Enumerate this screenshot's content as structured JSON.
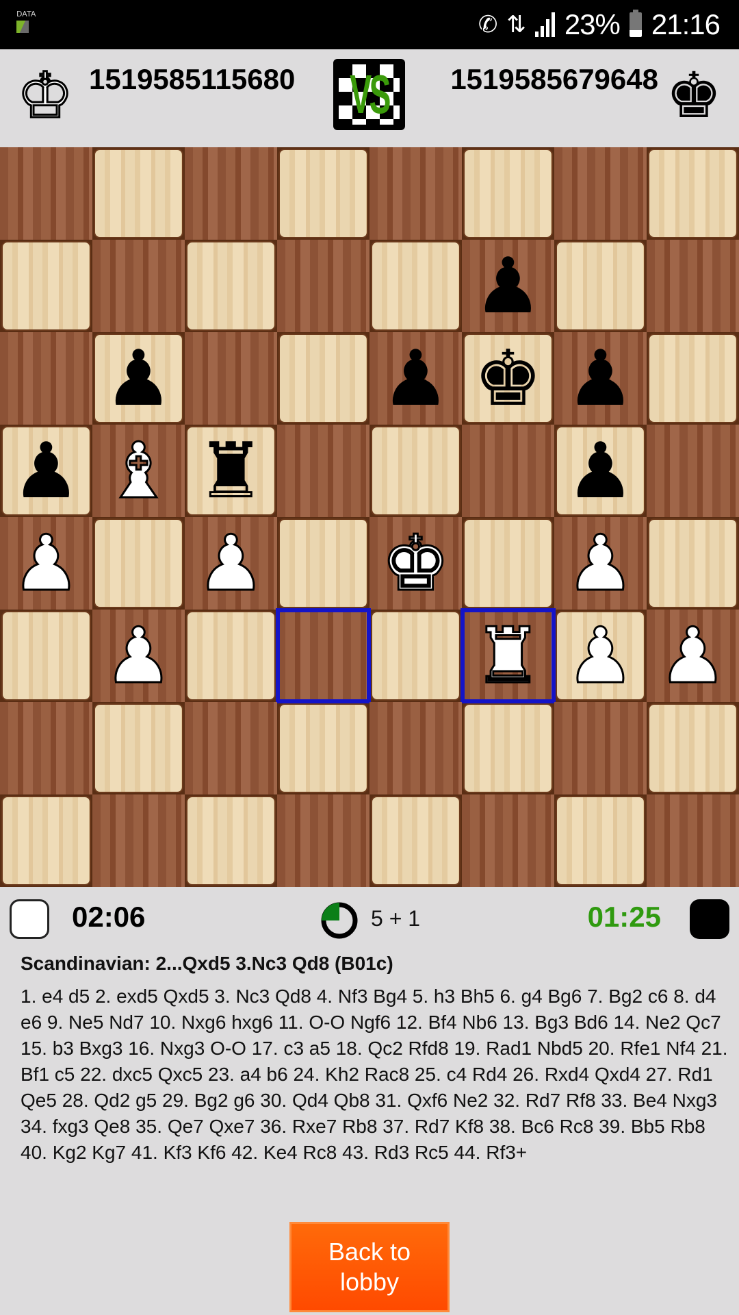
{
  "status_bar": {
    "data_label": "DATA",
    "battery_percent": "23%",
    "battery_level": 0.23,
    "time": "21:16",
    "icons": [
      "call-wifi-icon",
      "wifi-icon",
      "signal-icon",
      "battery-icon"
    ]
  },
  "header": {
    "player_white": {
      "name": "1519585115680",
      "icon": "white-king-icon"
    },
    "player_black": {
      "name": "1519585679648",
      "icon": "black-king-icon"
    },
    "vs_label": "VS"
  },
  "board": {
    "orientation": "white-bottom",
    "highlighted_squares": [
      "d3",
      "f3"
    ],
    "pieces": [
      {
        "square": "f7",
        "color": "b",
        "type": "pawn",
        "glyph": "♟"
      },
      {
        "square": "b6",
        "color": "b",
        "type": "pawn",
        "glyph": "♟"
      },
      {
        "square": "e6",
        "color": "b",
        "type": "pawn",
        "glyph": "♟"
      },
      {
        "square": "f6",
        "color": "b",
        "type": "king",
        "glyph": "♚"
      },
      {
        "square": "g6",
        "color": "b",
        "type": "pawn",
        "glyph": "♟"
      },
      {
        "square": "a5",
        "color": "b",
        "type": "pawn",
        "glyph": "♟"
      },
      {
        "square": "b5",
        "color": "w",
        "type": "bishop",
        "glyph": "♝"
      },
      {
        "square": "c5",
        "color": "b",
        "type": "rook",
        "glyph": "♜"
      },
      {
        "square": "g5",
        "color": "b",
        "type": "pawn",
        "glyph": "♟"
      },
      {
        "square": "a4",
        "color": "w",
        "type": "pawn",
        "glyph": "♟"
      },
      {
        "square": "c4",
        "color": "w",
        "type": "pawn",
        "glyph": "♟"
      },
      {
        "square": "e4",
        "color": "w",
        "type": "king",
        "glyph": "♚"
      },
      {
        "square": "g4",
        "color": "w",
        "type": "pawn",
        "glyph": "♟"
      },
      {
        "square": "b3",
        "color": "w",
        "type": "pawn",
        "glyph": "♟"
      },
      {
        "square": "f3",
        "color": "w",
        "type": "rook",
        "glyph": "♜"
      },
      {
        "square": "g3",
        "color": "w",
        "type": "pawn",
        "glyph": "♟"
      },
      {
        "square": "h3",
        "color": "w",
        "type": "pawn",
        "glyph": "♟"
      }
    ]
  },
  "clocks": {
    "white_time": "02:06",
    "black_time": "01:25",
    "active_color_hex": "#2f9a0f",
    "time_control": "5 + 1",
    "timer_icon": "timer-icon",
    "timer_fraction": 0.25
  },
  "game_info": {
    "opening": "Scandinavian: 2...Qxd5 3.Nc3 Qd8 (B01c)",
    "moves": "1. e4 d5 2. exd5 Qxd5 3. Nc3 Qd8 4. Nf3 Bg4 5. h3 Bh5 6. g4 Bg6 7. Bg2 c6 8. d4 e6 9. Ne5 Nd7 10. Nxg6 hxg6 11. O-O Ngf6 12. Bf4 Nb6 13. Bg3 Bd6 14. Ne2 Qc7 15. b3 Bxg3 16. Nxg3 O-O 17. c3 a5 18. Qc2 Rfd8 19. Rad1 Nbd5 20. Rfe1 Nf4 21. Bf1 c5 22. dxc5 Qxc5 23. a4 b6 24. Kh2 Rac8 25. c4 Rd4 26. Rxd4 Qxd4 27. Rd1 Qe5 28. Qd2 g5 29. Bg2 g6 30. Qd4 Qb8 31. Qxf6 Ne2 32. Rd7 Rf8 33. Be4 Nxg3 34. fxg3 Qe8 35. Qe7 Qxe7 36. Rxe7 Rb8 37. Rd7 Kf8 38. Bc6 Rc8 39. Bb5 Rb8 40. Kg2 Kg7 41. Kf3 Kf6 42. Ke4 Rc8 43. Rd3 Rc5  44. Rf3+"
  },
  "actions": {
    "back_to_lobby_label": "Back to lobby",
    "button_color": "#ff5a00"
  }
}
